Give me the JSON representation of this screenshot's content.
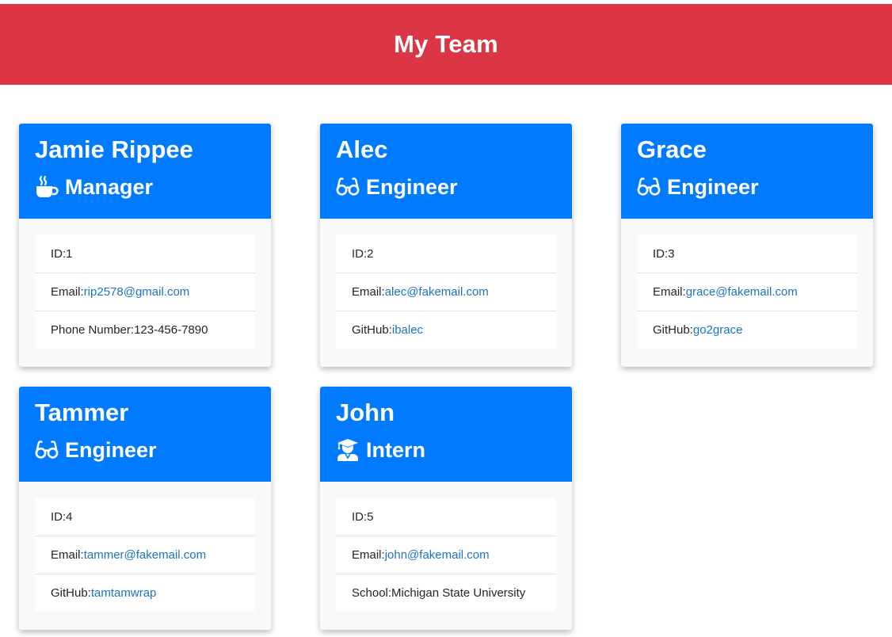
{
  "header": {
    "title": "My Team"
  },
  "team": [
    {
      "name": "Jamie Rippee",
      "role": "Manager",
      "icon": "coffee-icon",
      "id_label": "ID: ",
      "id_value": "1",
      "email_label": "Email: ",
      "email": "rip2578@gmail.com",
      "extra_label": "Phone Number: ",
      "extra_value": "123-456-7890"
    },
    {
      "name": "Alec",
      "role": "Engineer",
      "icon": "glasses-icon",
      "id_label": "ID: ",
      "id_value": "2",
      "email_label": "Email: ",
      "email": "alec@fakemail.com",
      "extra_label": "GitHub: ",
      "extra_value": "ibalec"
    },
    {
      "name": "Grace",
      "role": "Engineer",
      "icon": "glasses-icon",
      "id_label": "ID: ",
      "id_value": "3",
      "email_label": "Email: ",
      "email": "grace@fakemail.com",
      "extra_label": "GitHub: ",
      "extra_value": "go2grace"
    },
    {
      "name": "Tammer",
      "role": "Engineer",
      "icon": "glasses-icon",
      "id_label": "ID: ",
      "id_value": "4",
      "email_label": "Email: ",
      "email": "tammer@fakemail.com",
      "extra_label": "GitHub: ",
      "extra_value": "tamtamwrap"
    },
    {
      "name": "John",
      "role": "Intern",
      "icon": "graduate-icon",
      "id_label": "ID: ",
      "id_value": "5",
      "email_label": "Email: ",
      "email": "john@fakemail.com",
      "extra_label": "School: ",
      "extra_value": "Michigan State University"
    }
  ],
  "colors": {
    "banner": "#dc3545",
    "card_header": "#007bff",
    "link": "#1a73c9"
  }
}
